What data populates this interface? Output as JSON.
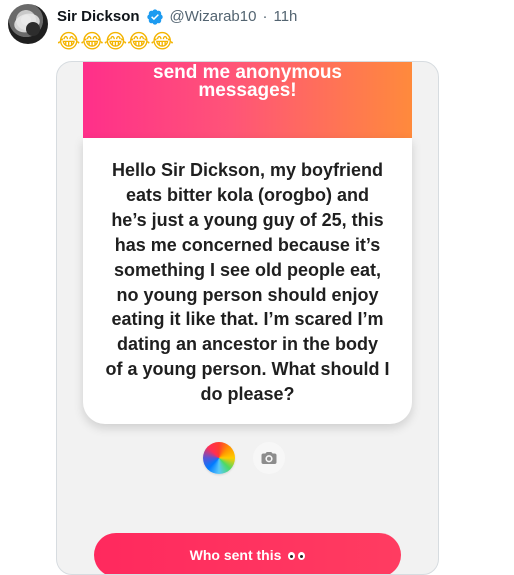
{
  "tweet": {
    "display_name": "Sir Dickson",
    "handle": "@Wizarab10",
    "separator": "·",
    "time": "11h",
    "emoji_text": "😂😂😂😂😂",
    "verified_icon": "verified-badge-icon"
  },
  "screenshot": {
    "banner_line_1": "send me anonymous",
    "banner_line_2": "messages!",
    "message": "Hello Sir Dickson, my boyfriend\neats bitter kola (orogbo) and\nhe’s just a young guy of 25, this\nhas me concerned because it’s\nsomething I see old people eat,\nno young person should enjoy\neating it like that. I’m scared I’m\ndating an ancestor in the body\nof a young person. What should I\ndo please?",
    "button_label": "Who sent this",
    "icons": {
      "color_picker": "color-wheel-icon",
      "camera": "camera-icon",
      "eyes": "eyes-icon"
    }
  },
  "colors": {
    "gradient_start": "#ff2f8a",
    "gradient_end": "#ff8a3c",
    "button": "#ff295e",
    "verified": "#1d9bf0"
  }
}
